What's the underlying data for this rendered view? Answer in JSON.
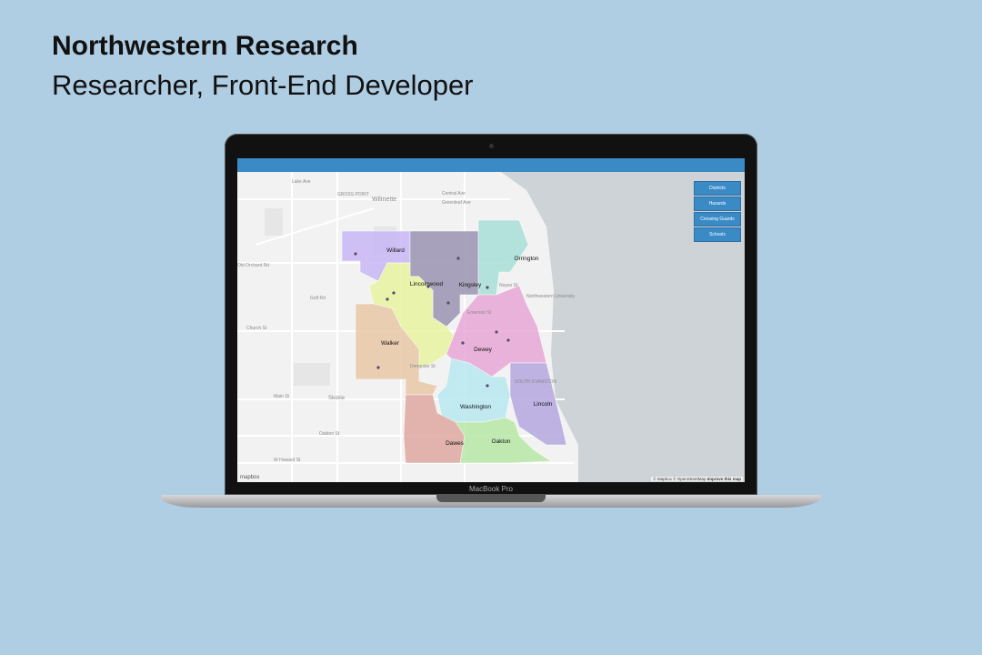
{
  "heading": {
    "title": "Northwestern Research",
    "subtitle": "Researcher, Front-End Developer"
  },
  "device": {
    "label": "MacBook Pro"
  },
  "map": {
    "layer_buttons": [
      "Districts",
      "Hazards",
      "Crossing Guards",
      "Schools"
    ],
    "districts": [
      {
        "name": "Willard",
        "color": "#c8b8f5"
      },
      {
        "name": "Orrington",
        "color": "#a8e0d8"
      },
      {
        "name": "Kingsley",
        "color": "#9a94b2"
      },
      {
        "name": "Lincolnwood",
        "color": "#e8f4a0"
      },
      {
        "name": "Walker",
        "color": "#e8c8a8"
      },
      {
        "name": "Dewey",
        "color": "#e8a8d8"
      },
      {
        "name": "Washington",
        "color": "#b8e8f0"
      },
      {
        "name": "Lincoln",
        "color": "#b4a8e0"
      },
      {
        "name": "Dawes",
        "color": "#e0a8a0"
      },
      {
        "name": "Oakton",
        "color": "#b8e8a8"
      }
    ],
    "place_labels": [
      "Wilmette",
      "GROSS POINT",
      "Central Ave",
      "Greenleaf Ave",
      "Lake Ave",
      "Old Orchard Rd",
      "Golf Rd",
      "Church St",
      "Main St",
      "Oakton St",
      "W Howard St",
      "Skokie",
      "Northwestern University",
      "SOUTH EVANSTON",
      "Emerson St",
      "Dempster St",
      "Noyes St"
    ],
    "attribution": {
      "prefix": "© Mapbox © OpenStreetMap",
      "link": "Improve this map"
    },
    "logo": "mapbox"
  }
}
